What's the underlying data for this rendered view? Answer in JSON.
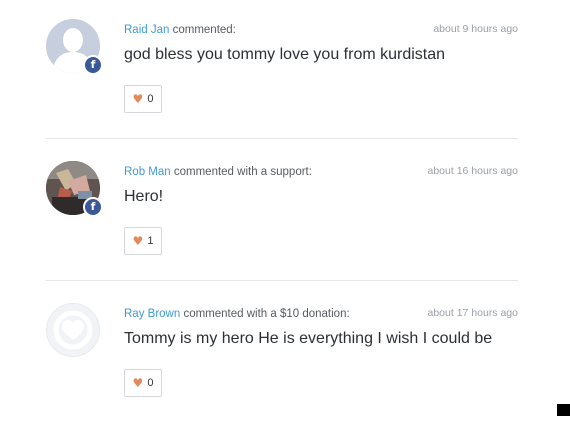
{
  "comments": [
    {
      "author": "Raid Jan",
      "action": "commented:",
      "time": "about 9 hours ago",
      "message": "god bless you tommy love you from kurdistan",
      "likes": "0",
      "avatar": "default-user-avatar",
      "badge": "f"
    },
    {
      "author": "Rob Man",
      "action": "commented with a support:",
      "time": "about 16 hours ago",
      "message": "Hero!",
      "likes": "1",
      "avatar": "user-photo-avatar",
      "badge": "f"
    },
    {
      "author": "Ray Brown",
      "action": "commented with a $10 donation:",
      "time": "about 17 hours ago",
      "message": "Tommy is my hero He is everything I wish I could be",
      "likes": "0",
      "avatar": "heart-logo-avatar"
    }
  ],
  "icons": {
    "like": "heart-icon",
    "badge": "facebook-icon"
  },
  "colors": {
    "author": "#3e9bd6",
    "heart": "#e28a5a",
    "facebook": "#3b5998"
  }
}
